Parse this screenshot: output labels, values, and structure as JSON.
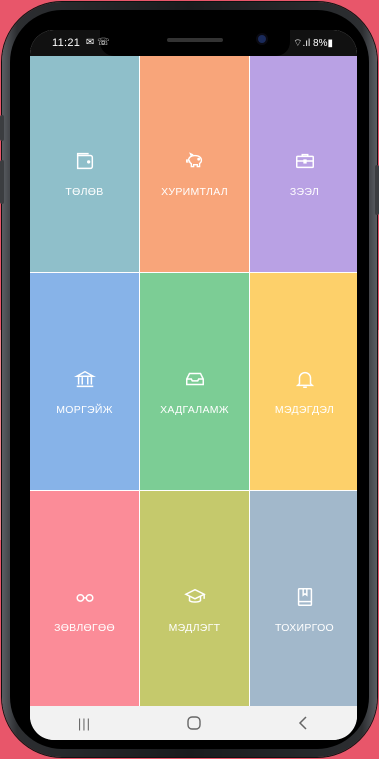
{
  "status_bar": {
    "time": "11:21",
    "notif_icons": "✉ ☏",
    "right_text": "⌔.ıl 8%▮"
  },
  "tiles": [
    {
      "label": "ТӨЛӨВ",
      "icon": "wallet-icon",
      "color": "#8fbfca"
    },
    {
      "label": "ХУРИМТЛАЛ",
      "icon": "piggy-bank-icon",
      "color": "#f8a57a"
    },
    {
      "label": "ЗЭЭЛ",
      "icon": "briefcase-icon",
      "color": "#b9a1e4"
    },
    {
      "label": "МОРГЭЙЖ",
      "icon": "bank-icon",
      "color": "#87b3e8"
    },
    {
      "label": "ХАДГАЛАМЖ",
      "icon": "inbox-icon",
      "color": "#7ccd95"
    },
    {
      "label": "МЭДЭГДЭЛ",
      "icon": "bell-icon",
      "color": "#fdd06a"
    },
    {
      "label": "ЗӨВЛӨГӨӨ",
      "icon": "glasses-icon",
      "color": "#fb8c98"
    },
    {
      "label": "МЭДЛЭГТ",
      "icon": "graduation-cap-icon",
      "color": "#c5c96c"
    },
    {
      "label": "ТОХИРГОО",
      "icon": "book-icon",
      "color": "#a2b8cb"
    }
  ],
  "nav": {
    "recent_icon": "|||",
    "home_icon": "○",
    "back_icon": "<"
  }
}
